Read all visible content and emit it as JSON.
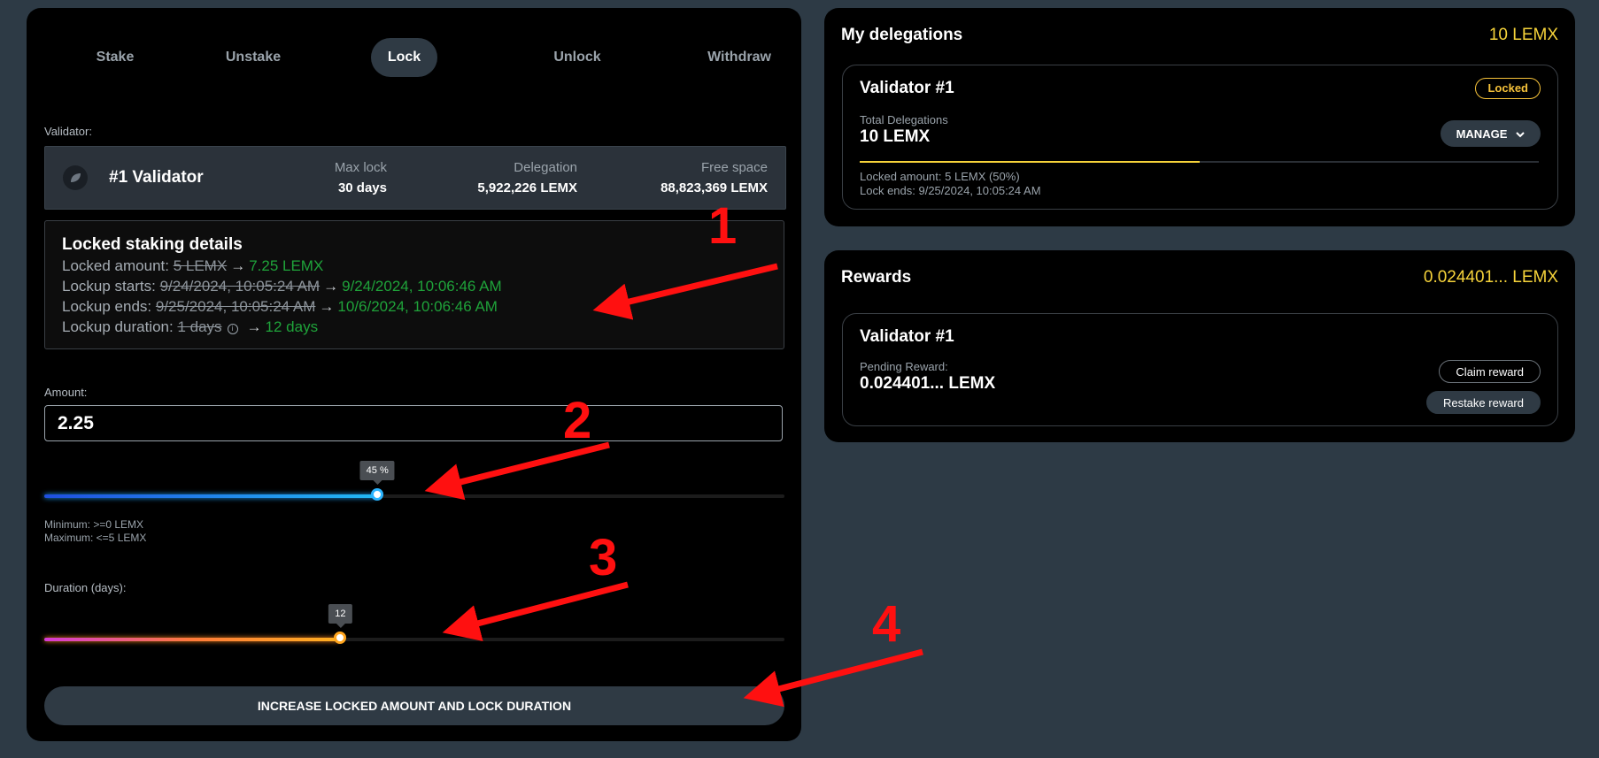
{
  "tabs": [
    {
      "label": "Stake"
    },
    {
      "label": "Unstake"
    },
    {
      "label": "Lock"
    },
    {
      "label": "Unlock"
    },
    {
      "label": "Withdraw"
    }
  ],
  "validator": {
    "label": "Validator:",
    "name": "#1 Validator",
    "max_lock_label": "Max lock",
    "max_lock_value": "30 days",
    "delegation_label": "Delegation",
    "delegation_value": "5,922,226 LEMX",
    "free_space_label": "Free space",
    "free_space_value": "88,823,369 LEMX"
  },
  "details": {
    "title": "Locked staking details",
    "locked_amount": {
      "label": "Locked amount:",
      "old": "5 LEMX",
      "new": "7.25 LEMX"
    },
    "lockup_starts": {
      "label": "Lockup starts:",
      "old": "9/24/2024, 10:05:24 AM",
      "new": "9/24/2024, 10:06:46 AM"
    },
    "lockup_ends": {
      "label": "Lockup ends:",
      "old": "9/25/2024, 10:05:24 AM",
      "new": "10/6/2024, 10:06:46 AM"
    },
    "lockup_duration": {
      "label": "Lockup duration:",
      "old": "1 days",
      "new": "12 days"
    }
  },
  "amount": {
    "label": "Amount:",
    "value": "2.25",
    "slider_percent": 45,
    "slider_tip": "45 %",
    "minimum": "Minimum: >=0 LEMX",
    "maximum": "Maximum: <=5 LEMX"
  },
  "duration": {
    "label": "Duration (days):",
    "value": 12,
    "max": 30,
    "tip": "12"
  },
  "main_button_label": "INCREASE LOCKED AMOUNT AND LOCK DURATION",
  "delegations": {
    "title": "My delegations",
    "total": "10 LEMX",
    "card": {
      "title": "Validator #1",
      "badge": "Locked",
      "total_label": "Total Delegations",
      "total_value": "10 LEMX",
      "manage_label": "MANAGE",
      "locked_fraction": 0.5,
      "locked_amount": "Locked amount: 5 LEMX (50%)",
      "lock_ends": "Lock ends: 9/25/2024, 10:05:24 AM"
    }
  },
  "rewards": {
    "title": "Rewards",
    "total": "0.024401... LEMX",
    "card": {
      "title": "Validator #1",
      "pending_label": "Pending Reward:",
      "pending_value": "0.024401... LEMX",
      "claim_label": "Claim reward",
      "restake_label": "Restake reward"
    }
  },
  "annotations": [
    "1",
    "2",
    "3",
    "4"
  ],
  "colors": {
    "accent_yellow": "#f6d33a",
    "new_value_green": "#1fa33a",
    "annotation_red": "#ff1010",
    "panel_bg": "#000000",
    "page_bg": "#2d3a45"
  }
}
